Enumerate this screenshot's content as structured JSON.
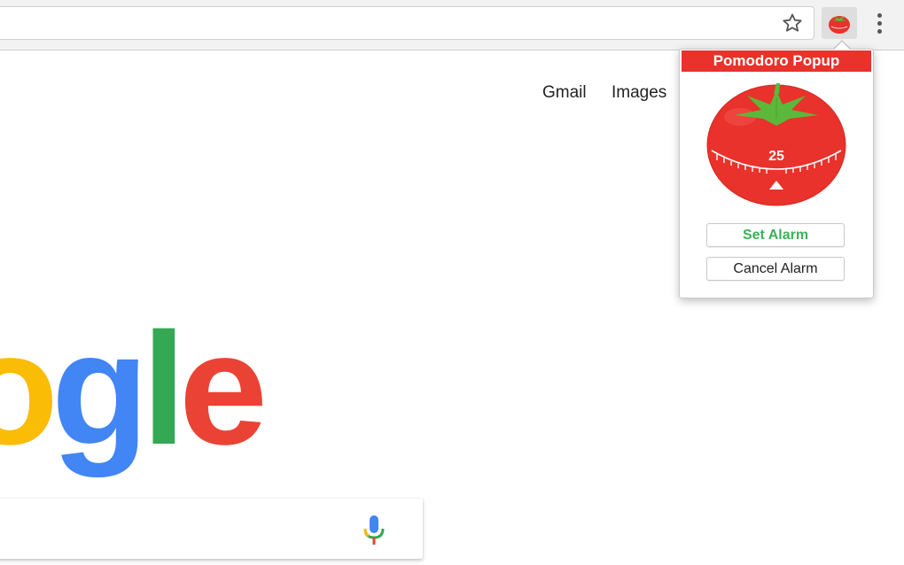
{
  "toolbar": {
    "star_icon": "star-outline-icon",
    "extension_icon": "tomato-icon",
    "menu_icon": "vertical-dots-icon"
  },
  "page": {
    "links": {
      "gmail": "Gmail",
      "images": "Images"
    },
    "logo_text": "ogle"
  },
  "popup": {
    "title": "Pomodoro Popup",
    "timer_number": "25",
    "set_alarm_label": "Set Alarm",
    "cancel_alarm_label": "Cancel Alarm",
    "colors": {
      "header": "#e8322b",
      "tomato": "#e8322b",
      "leaves": "#5cb83a",
      "set_alarm_text": "#3cb15a"
    }
  }
}
